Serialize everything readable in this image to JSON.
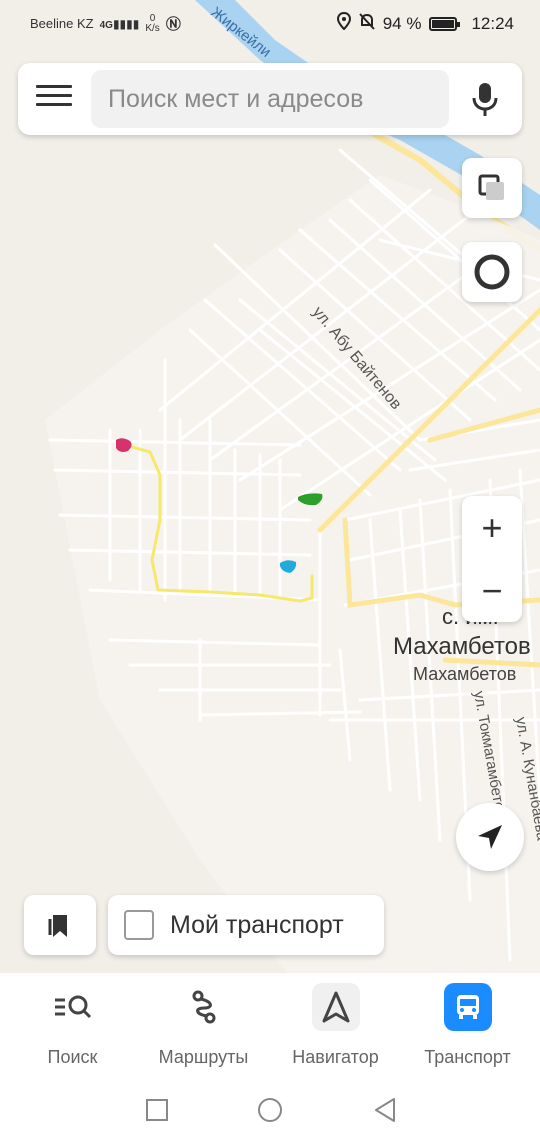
{
  "status_bar": {
    "carrier": "Beeline KZ",
    "network": "4G",
    "speed_value": "0",
    "speed_unit": "K/s",
    "battery": "94 %",
    "time": "12:24"
  },
  "search": {
    "placeholder": "Поиск мест и адресов"
  },
  "map": {
    "labels": {
      "street_abu": "ул. Абу Байтенов",
      "river": "Жиркейли",
      "village_prefix": "с. им.",
      "village_name": "Махамбетов",
      "village_sub": "Махамбетов",
      "street_tokmag": "ул. Токмагамбетова",
      "street_kunanbaev": "ул. А. Кунанбаева"
    },
    "colors": {
      "background": "#f2efe9",
      "road": "#ffffff",
      "main_road": "#fbe69a",
      "river": "#a9d3f0",
      "route": "#f5e86a",
      "marker_pink": "#d6336c",
      "marker_green": "#2aa02a",
      "marker_cyan": "#22aadd"
    }
  },
  "controls": {
    "zoom_in": "+",
    "zoom_out": "−"
  },
  "transport_toggle": {
    "label": "Мой транспорт"
  },
  "tabs": [
    {
      "label": "Поиск",
      "icon": "search-list-icon"
    },
    {
      "label": "Маршруты",
      "icon": "route-icon"
    },
    {
      "label": "Навигатор",
      "icon": "navigator-arrow-icon"
    },
    {
      "label": "Транспорт",
      "icon": "bus-icon",
      "active": true
    }
  ]
}
